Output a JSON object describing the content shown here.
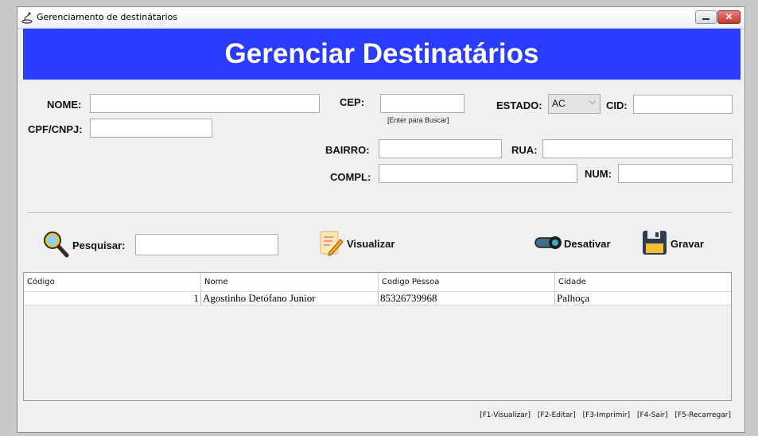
{
  "window": {
    "title": "Gerenciamento de destinátarios"
  },
  "banner": {
    "title": "Gerenciar Destinatários"
  },
  "form": {
    "nome_label": "NOME:",
    "cpf_label": "CPF/CNPJ:",
    "cep_label": "CEP:",
    "cep_hint": "[Enter para Buscar]",
    "estado_label": "ESTADO:",
    "estado_value": "AC",
    "cid_label": "CID:",
    "bairro_label": "BAIRRO:",
    "rua_label": "RUA:",
    "compl_label": "COMPL:",
    "num_label": "NUM:"
  },
  "toolbar": {
    "pesquisar_label": "Pesquisar:",
    "visualizar_label": "Visualizar",
    "desativar_label": "Desativar",
    "gravar_label": "Gravar"
  },
  "table": {
    "columns": [
      "Código",
      "Nome",
      "Codigo Pessoa",
      "Cidade"
    ],
    "rows": [
      [
        "1",
        "Agostinho Detófano Junior",
        "85326739968",
        "Palhoça"
      ]
    ]
  },
  "shortcuts": [
    "[F1-Visualizar]",
    "[F2-Editar]",
    "[F3-Imprimir]",
    "[F4-Sair]",
    "[F5-Recarregar]"
  ],
  "colors": {
    "banner": "#2c3cff"
  }
}
